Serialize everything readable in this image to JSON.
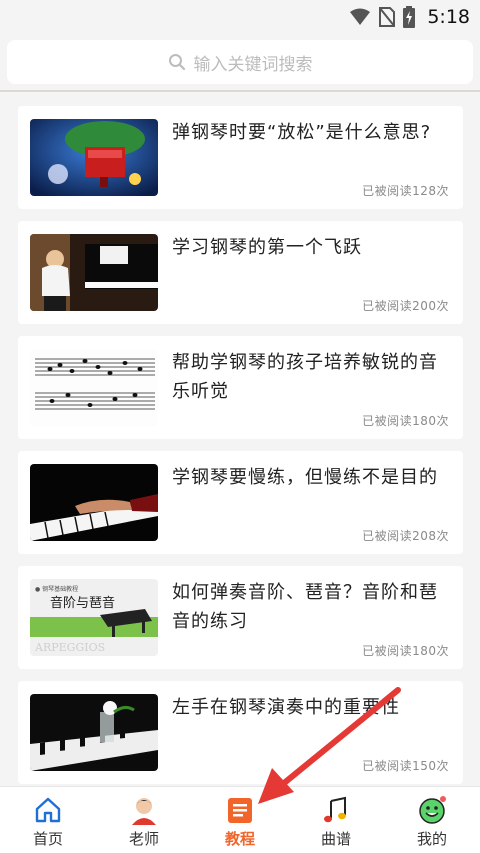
{
  "status": {
    "time": "5:18"
  },
  "search": {
    "placeholder": "输入关键词搜索"
  },
  "articles": [
    {
      "title": "弹钢琴时要“放松”是什么意思?",
      "reads": "已被阅读128次"
    },
    {
      "title": "学习钢琴的第一个飞跃",
      "reads": "已被阅读200次"
    },
    {
      "title": "帮助学钢琴的孩子培养敏锐的音乐听觉",
      "reads": "已被阅读180次"
    },
    {
      "title": "学钢琴要慢练，但慢练不是目的",
      "reads": "已被阅读208次"
    },
    {
      "title": "如何弹奏音阶、琶音？音阶和琶音的练习",
      "reads": "已被阅读180次",
      "thumb_text": "音阶与琶音"
    },
    {
      "title": "左手在钢琴演奏中的重要性",
      "reads": "已被阅读150次"
    }
  ],
  "tabs": [
    {
      "label": "首页",
      "icon": "home-icon"
    },
    {
      "label": "老师",
      "icon": "teacher-icon"
    },
    {
      "label": "教程",
      "icon": "tutorial-icon",
      "active": true
    },
    {
      "label": "曲谱",
      "icon": "sheet-music-icon"
    },
    {
      "label": "我的",
      "icon": "profile-icon"
    }
  ],
  "colors": {
    "accent": "#f2652a",
    "annotation_arrow": "#e53935"
  }
}
